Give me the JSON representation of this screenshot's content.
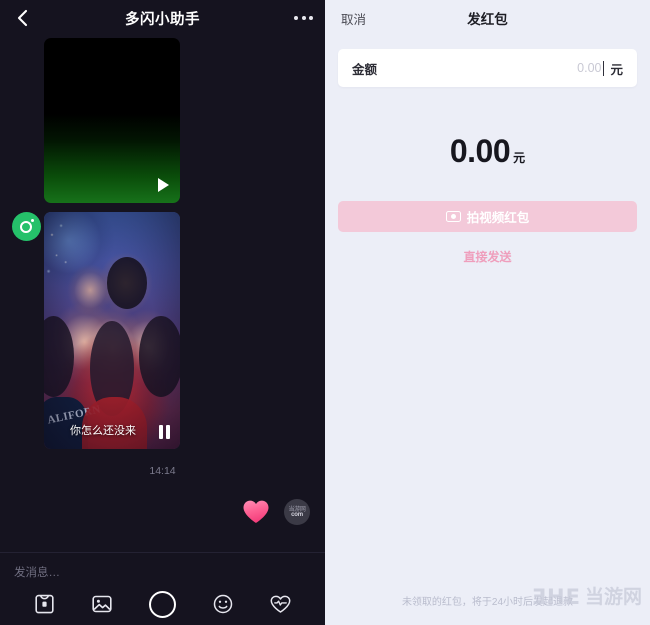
{
  "chat": {
    "title": "多闪小助手",
    "back_icon": "chevron-left-icon",
    "more_icon": "more-horizontal-icon",
    "messages": [
      {
        "type": "video",
        "caption": "",
        "control": "play"
      },
      {
        "type": "video",
        "caption": "你怎么还没来",
        "control": "pause"
      }
    ],
    "timestamp": "14:14",
    "reactions": {
      "heart_icon": "heart-sticker",
      "avatar_watermark_top": "当游网",
      "avatar_watermark_bottom": "com"
    },
    "composer": {
      "placeholder": "发消息…",
      "tools": [
        {
          "name": "red-packet-icon",
          "label": "红包"
        },
        {
          "name": "image-icon",
          "label": "图片"
        },
        {
          "name": "shutter-icon",
          "label": "拍摄"
        },
        {
          "name": "emoji-icon",
          "label": "表情"
        },
        {
          "name": "heart-icon",
          "label": "喜欢"
        }
      ]
    }
  },
  "red_packet": {
    "cancel_label": "取消",
    "title": "发红包",
    "amount_field": {
      "label": "金额",
      "placeholder": "0.00",
      "unit": "元",
      "value": ""
    },
    "big_amount": {
      "value": "0.00",
      "unit": "元"
    },
    "primary_button": {
      "label": "拍视频红包",
      "icon": "camera-icon",
      "color": "#f3c9d9"
    },
    "secondary_link": {
      "label": "直接发送",
      "color": "#ef9ebc"
    },
    "footer_note": "未领取的红包，将于24小时后发起退款",
    "watermark": {
      "logo": "3HE",
      "text": "当游网"
    }
  },
  "theme": {
    "chat_bg": "#15131f",
    "panel_bg": "#eceef7",
    "accent_pink": "#ef9ebc",
    "avatar_green": "#25c16a"
  }
}
